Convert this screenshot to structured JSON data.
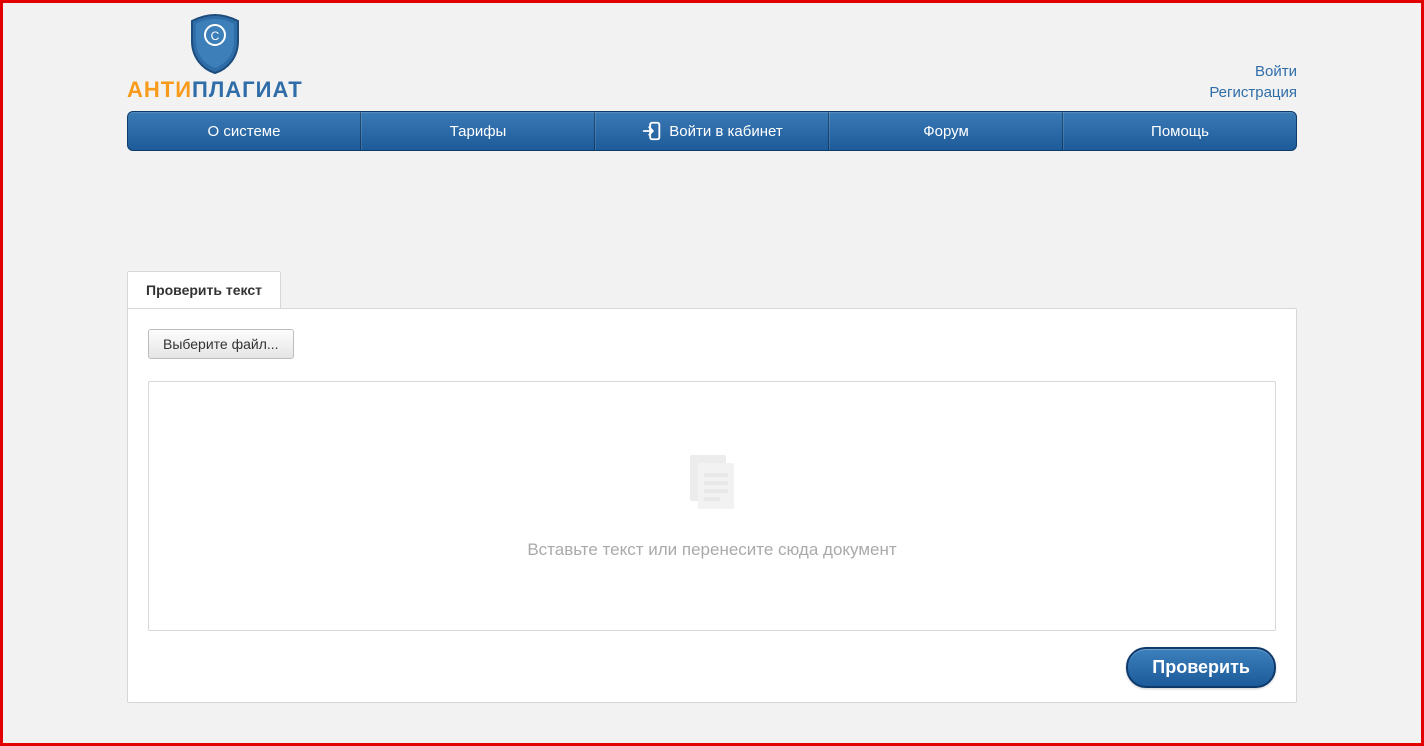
{
  "logo": {
    "part1": "АНТИ",
    "part2": "ПЛАГИАТ"
  },
  "auth": {
    "login": "Войти",
    "register": "Регистрация"
  },
  "nav": {
    "about": "О системе",
    "tariffs": "Тарифы",
    "cabinet": "Войти в кабинет",
    "forum": "Форум",
    "help": "Помощь"
  },
  "check": {
    "tab_label": "Проверить текст",
    "file_button": "Выберите файл...",
    "drop_placeholder": "Вставьте текст или перенесите сюда документ",
    "submit": "Проверить"
  }
}
